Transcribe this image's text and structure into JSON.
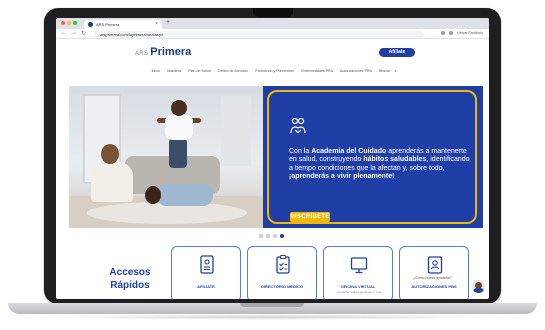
{
  "browser": {
    "tab_title": "ARS Primera",
    "new_tab_symbol": "+",
    "tab_close_symbol": "×",
    "url": "arsprimera.com/laprimerahora.aspx",
    "toolbar_label": "Ubicar Escritorio",
    "nav_back": "←",
    "nav_forward": "→",
    "nav_reload": "↻"
  },
  "site": {
    "logo_ars": "ARS",
    "logo_primera": "Primera",
    "afiliate_label": "Afíliate",
    "nav": [
      "Inicio",
      "Nosotros",
      "Plan de Salud",
      "Centro de Atención",
      "Promoción y Prevención",
      "Enfermedades PRA",
      "Autorizaciones PRA",
      "Buscar"
    ],
    "search_icon": "search-icon"
  },
  "hero": {
    "text_pre": "Con la ",
    "text_bold1": "Academia del Cuidado",
    "text_mid1": " aprenderás a mantenerte en salud, construyendo ",
    "text_bold2": "hábitos saludables",
    "text_mid2": ", identificando a tiempo condiciones que la afectan y, sobre todo, ",
    "text_bold3": "¡aprenderás a vivir plenamente!",
    "cta_label": "INSCRÍBETE",
    "slide_count": 4,
    "active_slide": 4
  },
  "accesos": {
    "title_line1": "Accesos",
    "title_line2": "Rápidos",
    "cards": [
      {
        "label": "AFÍLIATE",
        "sub": "",
        "icon": "document-icon"
      },
      {
        "label": "DIRECTORIO MÉDICO",
        "sub": "",
        "icon": "checklist-icon"
      },
      {
        "label": "OFICINA VIRTUAL",
        "sub": "Consulta, realiza gestiones y más",
        "icon": "monitor-icon"
      },
      {
        "label": "AUTORIZACIONES PBS",
        "sub": "",
        "icon": "id-card-icon"
      }
    ],
    "chat_prompt": "¿Cómo puedo ayudarte?"
  },
  "colors": {
    "brand_blue": "#1f3fa6",
    "accent_yellow": "#f2b705"
  }
}
